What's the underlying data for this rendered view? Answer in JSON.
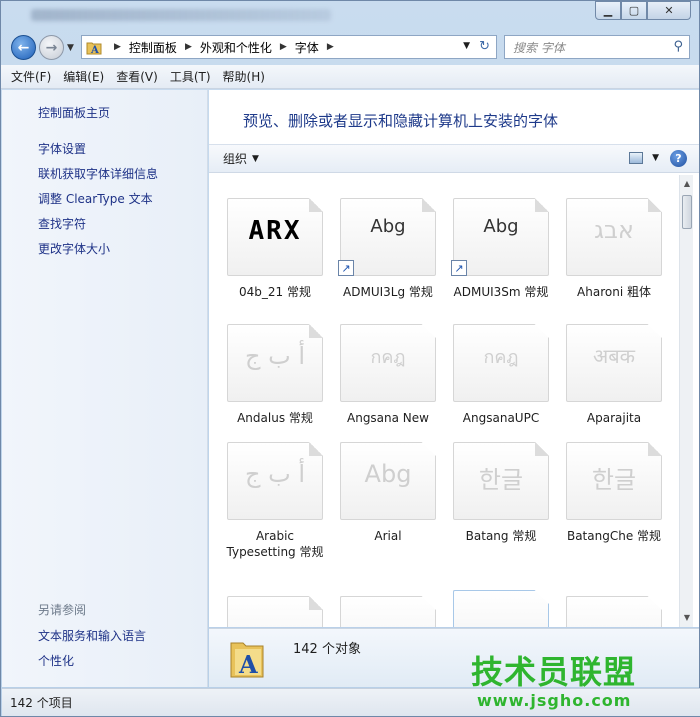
{
  "nav": {
    "breadcrumbs": [
      "控制面板",
      "外观和个性化",
      "字体"
    ],
    "search_placeholder": "搜索 字体"
  },
  "menu": [
    "文件(F)",
    "编辑(E)",
    "查看(V)",
    "工具(T)",
    "帮助(H)"
  ],
  "sidebar": {
    "items": [
      "控制面板主页",
      "字体设置",
      "联机获取字体详细信息",
      "调整 ClearType 文本",
      "查找字符",
      "更改字体大小"
    ],
    "see_also_heading": "另请参阅",
    "see_also": [
      "文本服务和输入语言",
      "个性化"
    ]
  },
  "main": {
    "title": "预览、删除或者显示和隐藏计算机上安装的字体",
    "organize": "组织"
  },
  "fonts": [
    {
      "name": "04b_21 常规",
      "sample": "ARX"
    },
    {
      "name": "ADMUI3Lg 常规",
      "sample": "Abg"
    },
    {
      "name": "ADMUI3Sm 常规",
      "sample": "Abg"
    },
    {
      "name": "Aharoni 粗体",
      "sample": "אבג"
    },
    {
      "name": "Andalus 常规",
      "sample": "أ ب ج"
    },
    {
      "name": "Angsana New",
      "sample": "กคฎ"
    },
    {
      "name": "AngsanaUPC",
      "sample": "กคฎ"
    },
    {
      "name": "Aparajita",
      "sample": "अबक"
    },
    {
      "name": "Arabic Typesetting 常规",
      "sample": "أ ب ج"
    },
    {
      "name": "Arial",
      "sample": "Abg"
    },
    {
      "name": "Batang 常规",
      "sample": "한글"
    },
    {
      "name": "BatangChe 常规",
      "sample": "한글"
    }
  ],
  "details": {
    "count": "142 个对象"
  },
  "status": {
    "count": "142 个项目"
  },
  "watermark": {
    "text": "技术员联盟",
    "url": "www.jsgho.com"
  }
}
